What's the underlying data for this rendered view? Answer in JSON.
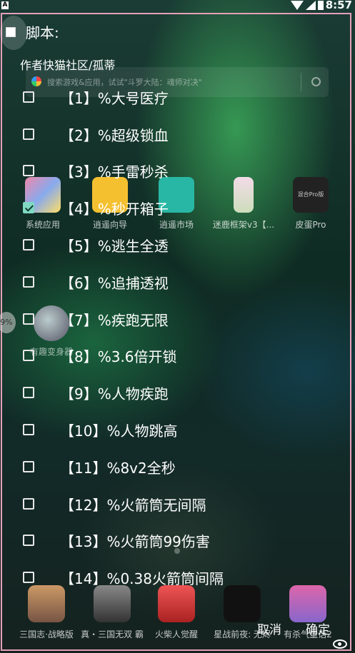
{
  "status_bar": {
    "time": "8:57",
    "left_badge": "A"
  },
  "launcher": {
    "search_placeholder": "搜索游戏&应用，试试\"斗罗大陆：魂师对决\"",
    "apps": [
      {
        "label": "系统应用",
        "icon": "folder-icon"
      },
      {
        "label": "逍遥向导",
        "icon": "guide-icon"
      },
      {
        "label": "逍遥市场",
        "icon": "market-icon"
      },
      {
        "label": "迷鹿框架v3【...",
        "icon": "app-icon"
      },
      {
        "label": "皮蛋Pro",
        "icon": "app-icon",
        "icon_text": "混合Pro版"
      }
    ],
    "floating_app": "有趣变身器",
    "dock": [
      "三国志·战略版",
      "真・三国无双 霸",
      "火柴人觉醒",
      "星战前夜: 无烬",
      "有杀气童话2"
    ]
  },
  "overlay": {
    "title": "脚本:",
    "author": "作者快猫社区/孤蒂",
    "items": [
      {
        "label": "【1】%大号医疗",
        "checked": false
      },
      {
        "label": "【2】%超级锁血",
        "checked": false
      },
      {
        "label": "【3】%手雷秒杀",
        "checked": false
      },
      {
        "label": "【4】%秒开箱子",
        "checked": true
      },
      {
        "label": "【5】%逃生全透",
        "checked": false
      },
      {
        "label": "【6】%追捕透视",
        "checked": false
      },
      {
        "label": "【7】%疾跑无限",
        "checked": false
      },
      {
        "label": "【8】%3.6倍开锁",
        "checked": false
      },
      {
        "label": "【9】%人物疾跑",
        "checked": false
      },
      {
        "label": "【10】%人物跳高",
        "checked": false
      },
      {
        "label": "【11】%8v2全秒",
        "checked": false
      },
      {
        "label": "【12】%火箭筒无间隔",
        "checked": false
      },
      {
        "label": "【13】%火箭筒99伤害",
        "checked": false
      },
      {
        "label": "【14】%0.38火箭筒间隔",
        "checked": false
      }
    ],
    "side_badge": "9%",
    "cancel_label": "取消",
    "ok_label": "确定"
  },
  "colors": {
    "accent": "#7fd9c2",
    "frame": "#e6a0b8"
  }
}
